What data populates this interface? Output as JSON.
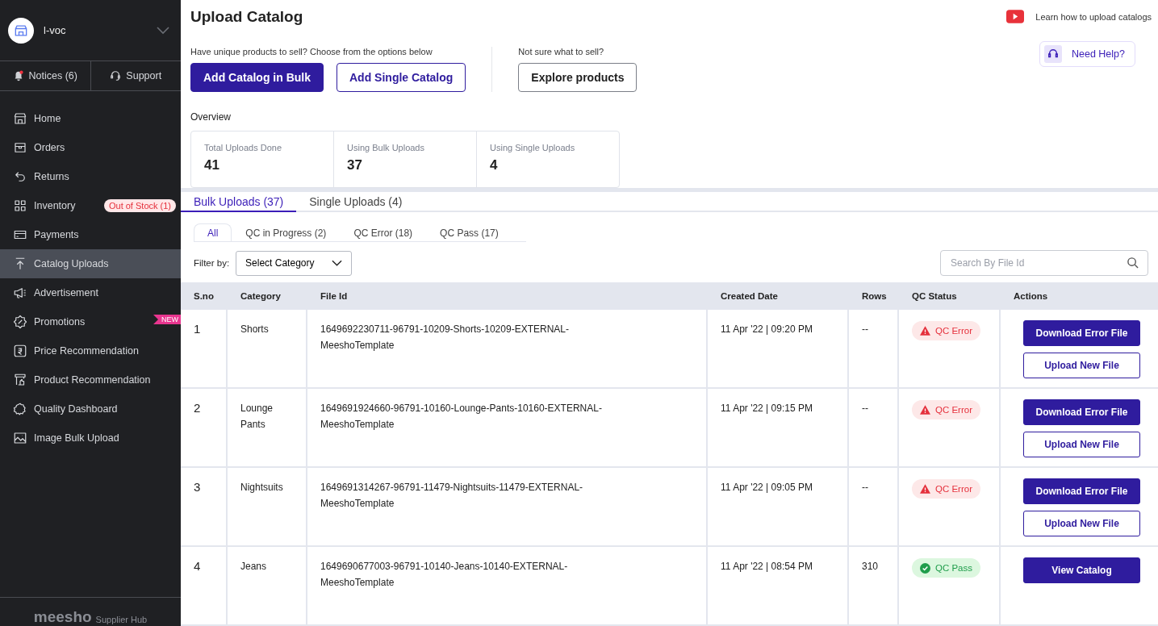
{
  "account": {
    "name": "l-voc"
  },
  "top_links": [
    {
      "label": "Notices (6)",
      "kind": "notices"
    },
    {
      "label": "Support",
      "kind": "support"
    }
  ],
  "sidebar": {
    "items": [
      {
        "label": "Home",
        "selected": false
      },
      {
        "label": "Orders",
        "selected": false
      },
      {
        "label": "Returns",
        "selected": false
      },
      {
        "label": "Inventory",
        "selected": false,
        "badge": "Out of Stock (1)"
      },
      {
        "label": "Payments",
        "selected": false
      },
      {
        "label": "Catalog Uploads",
        "selected": true
      },
      {
        "label": "Advertisement",
        "selected": false
      },
      {
        "label": "Promotions",
        "selected": false,
        "ribbon": "NEW"
      },
      {
        "label": "Price Recommendation",
        "selected": false
      },
      {
        "label": "Product Recommendation",
        "selected": false
      },
      {
        "label": "Quality Dashboard",
        "selected": false
      },
      {
        "label": "Image Bulk Upload",
        "selected": false
      }
    ],
    "footer": {
      "logo": "meesho",
      "tagline": "Supplier Hub"
    }
  },
  "page": {
    "title": "Upload Catalog",
    "learn_link": "Learn how to upload catalogs",
    "help_button": "Need Help?",
    "unique_prompt": "Have unique products to sell? Choose from the options below",
    "buttons": [
      {
        "label": "Add Catalog in Bulk",
        "kind": "primary"
      },
      {
        "label": "Add Single Catalog",
        "kind": "outline"
      }
    ],
    "explore_prompt": "Not sure what to sell?",
    "explore_button": "Explore products"
  },
  "overview": {
    "title": "Overview",
    "stats": [
      {
        "label": "Total Uploads Done",
        "value": "41"
      },
      {
        "label": "Using Bulk Uploads",
        "value": "37"
      },
      {
        "label": "Using Single Uploads",
        "value": "4"
      }
    ]
  },
  "tabs": [
    {
      "label": "Bulk Uploads (37)",
      "selected": true
    },
    {
      "label": "Single Uploads (4)",
      "selected": false
    }
  ],
  "sub_tabs": [
    {
      "label": "All",
      "selected": true
    },
    {
      "label": "QC in Progress (2)",
      "selected": false
    },
    {
      "label": "QC Error (18)",
      "selected": false
    },
    {
      "label": "QC Pass (17)",
      "selected": false
    }
  ],
  "filter": {
    "label": "Filter by:",
    "value": "Select Category"
  },
  "search": {
    "placeholder": "Search By File Id"
  },
  "table": {
    "columns": [
      "S.no",
      "Category",
      "File Id",
      "Created Date",
      "Rows",
      "QC Status",
      "Actions"
    ],
    "rows": [
      {
        "sno": "1",
        "category": "Shorts",
        "file_id": "1649692230711-96791-10209-Shorts-10209-EXTERNAL-MeeshoTemplate",
        "created": "11 Apr '22 | 09:20 PM",
        "rows": "--",
        "status": {
          "label": "QC Error",
          "kind": "error"
        },
        "actions": [
          {
            "label": "Download Error File",
            "kind": "primary"
          },
          {
            "label": "Upload New File",
            "kind": "outline"
          }
        ]
      },
      {
        "sno": "2",
        "category": "Lounge Pants",
        "file_id": "1649691924660-96791-10160-Lounge-Pants-10160-EXTERNAL-MeeshoTemplate",
        "created": "11 Apr '22 | 09:15 PM",
        "rows": "--",
        "status": {
          "label": "QC Error",
          "kind": "error"
        },
        "actions": [
          {
            "label": "Download Error File",
            "kind": "primary"
          },
          {
            "label": "Upload New File",
            "kind": "outline"
          }
        ]
      },
      {
        "sno": "3",
        "category": "Nightsuits",
        "file_id": "1649691314267-96791-11479-Nightsuits-11479-EXTERNAL-MeeshoTemplate",
        "created": "11 Apr '22 | 09:05 PM",
        "rows": "--",
        "status": {
          "label": "QC Error",
          "kind": "error"
        },
        "actions": [
          {
            "label": "Download Error File",
            "kind": "primary"
          },
          {
            "label": "Upload New File",
            "kind": "outline"
          }
        ]
      },
      {
        "sno": "4",
        "category": "Jeans",
        "file_id": "1649690677003-96791-10140-Jeans-10140-EXTERNAL-MeeshoTemplate",
        "created": "11 Apr '22 | 08:54 PM",
        "rows": "310",
        "status": {
          "label": "QC Pass",
          "kind": "pass"
        },
        "actions": [
          {
            "label": "View Catalog",
            "kind": "primary"
          }
        ]
      }
    ]
  }
}
